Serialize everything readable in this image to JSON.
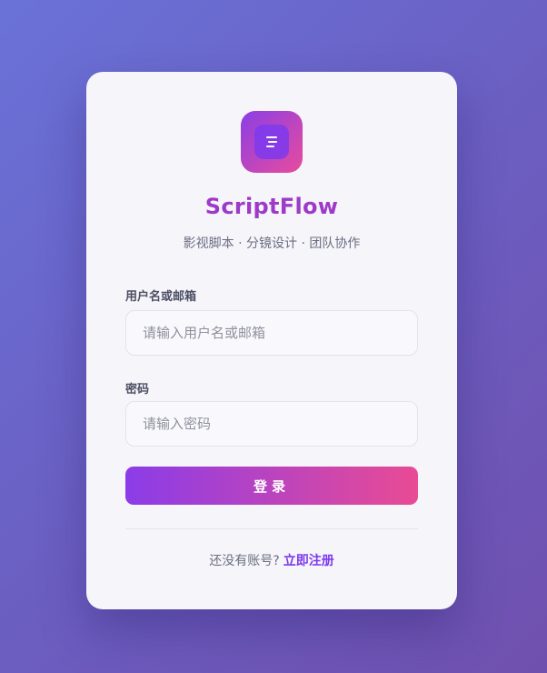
{
  "app": {
    "brand_name": "ScriptFlow",
    "tagline": "影视脚本 · 分镜设计 · 团队协作",
    "logo_icon": "document-lines-icon"
  },
  "form": {
    "username_label": "用户名或邮箱",
    "username_placeholder": "请输入用户名或邮箱",
    "username_value": "",
    "password_label": "密码",
    "password_placeholder": "请输入密码",
    "password_value": "",
    "login_button": "登录"
  },
  "footer": {
    "prompt": "还没有账号?",
    "register_link": "立即注册"
  },
  "colors": {
    "background_start": "#6a72d8",
    "background_end": "#7050ae",
    "brand_gradient_start": "#8a3fe6",
    "brand_gradient_end": "#e94b9c",
    "link": "#7c3aed"
  }
}
